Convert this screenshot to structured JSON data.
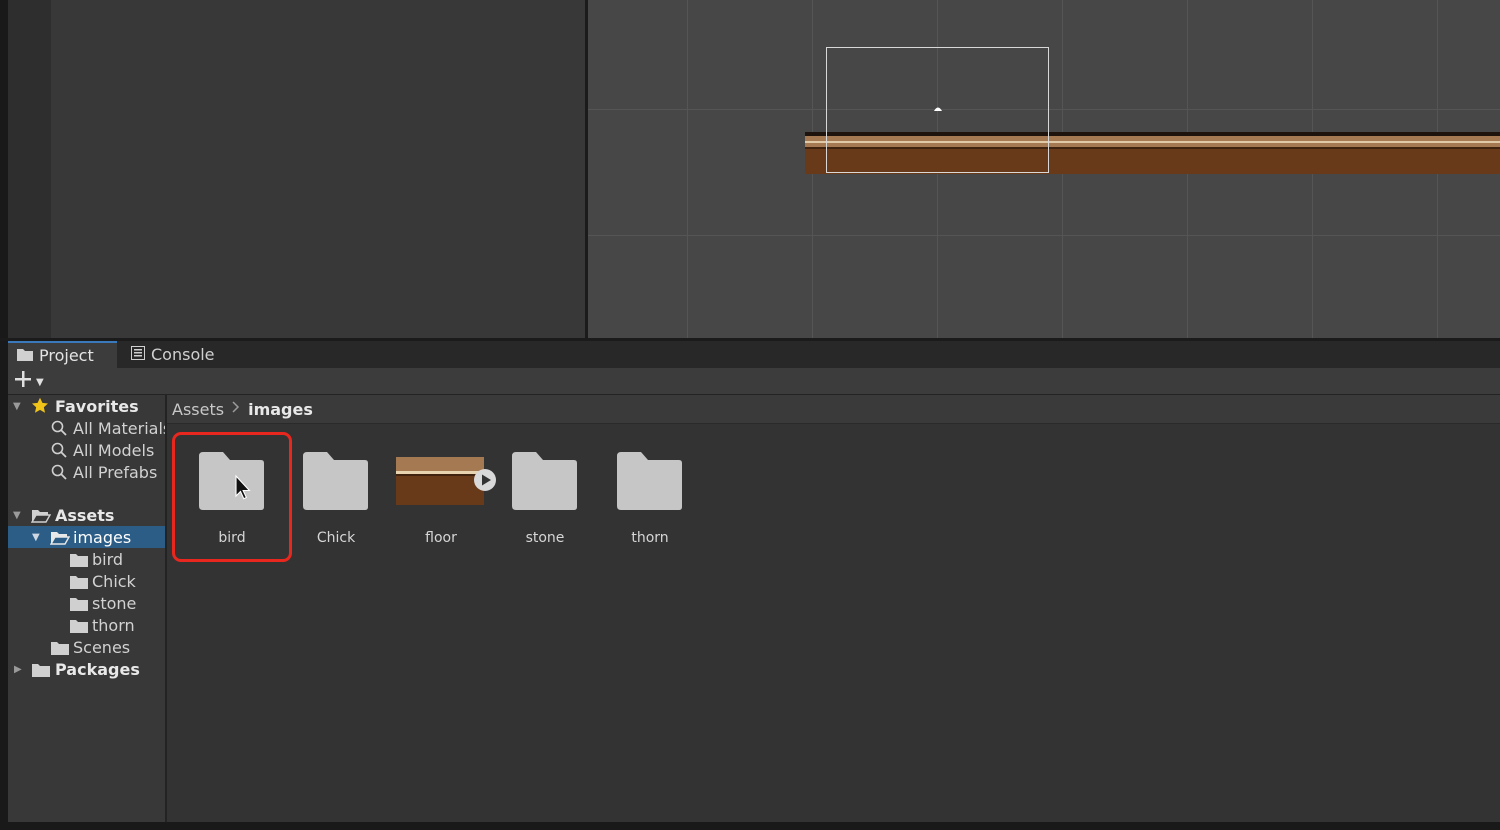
{
  "tabs": {
    "project_label": "Project",
    "project_icon": "folder-icon",
    "console_label": "Console",
    "console_icon": "console-icon"
  },
  "toolbar": {
    "add_icon": "plus-icon",
    "dropdown_icon": "chevron-down-icon"
  },
  "tree": {
    "favorites": {
      "label": "Favorites",
      "icon": "star-icon",
      "items": [
        {
          "label": "All Materials"
        },
        {
          "label": "All Models"
        },
        {
          "label": "All Prefabs"
        }
      ]
    },
    "assets": {
      "label": "Assets",
      "icon": "open-folder-icon",
      "images": {
        "label": "images",
        "icon": "open-folder-icon",
        "children": [
          {
            "label": "bird"
          },
          {
            "label": "Chick"
          },
          {
            "label": "stone"
          },
          {
            "label": "thorn"
          }
        ]
      },
      "scenes": {
        "label": "Scenes"
      }
    },
    "packages": {
      "label": "Packages"
    }
  },
  "breadcrumb": {
    "root": "Assets",
    "current": "images"
  },
  "grid": {
    "items": [
      {
        "label": "bird",
        "kind": "folder"
      },
      {
        "label": "Chick",
        "kind": "folder"
      },
      {
        "label": "floor",
        "kind": "sprite"
      },
      {
        "label": "stone",
        "kind": "folder"
      },
      {
        "label": "thorn",
        "kind": "folder"
      }
    ]
  },
  "colors": {
    "selection": "#2c5d87",
    "highlight_outline": "#e8271e",
    "floor_top": "#a57a52",
    "floor_body": "#693a1a",
    "folder": "#c6c6c6"
  }
}
